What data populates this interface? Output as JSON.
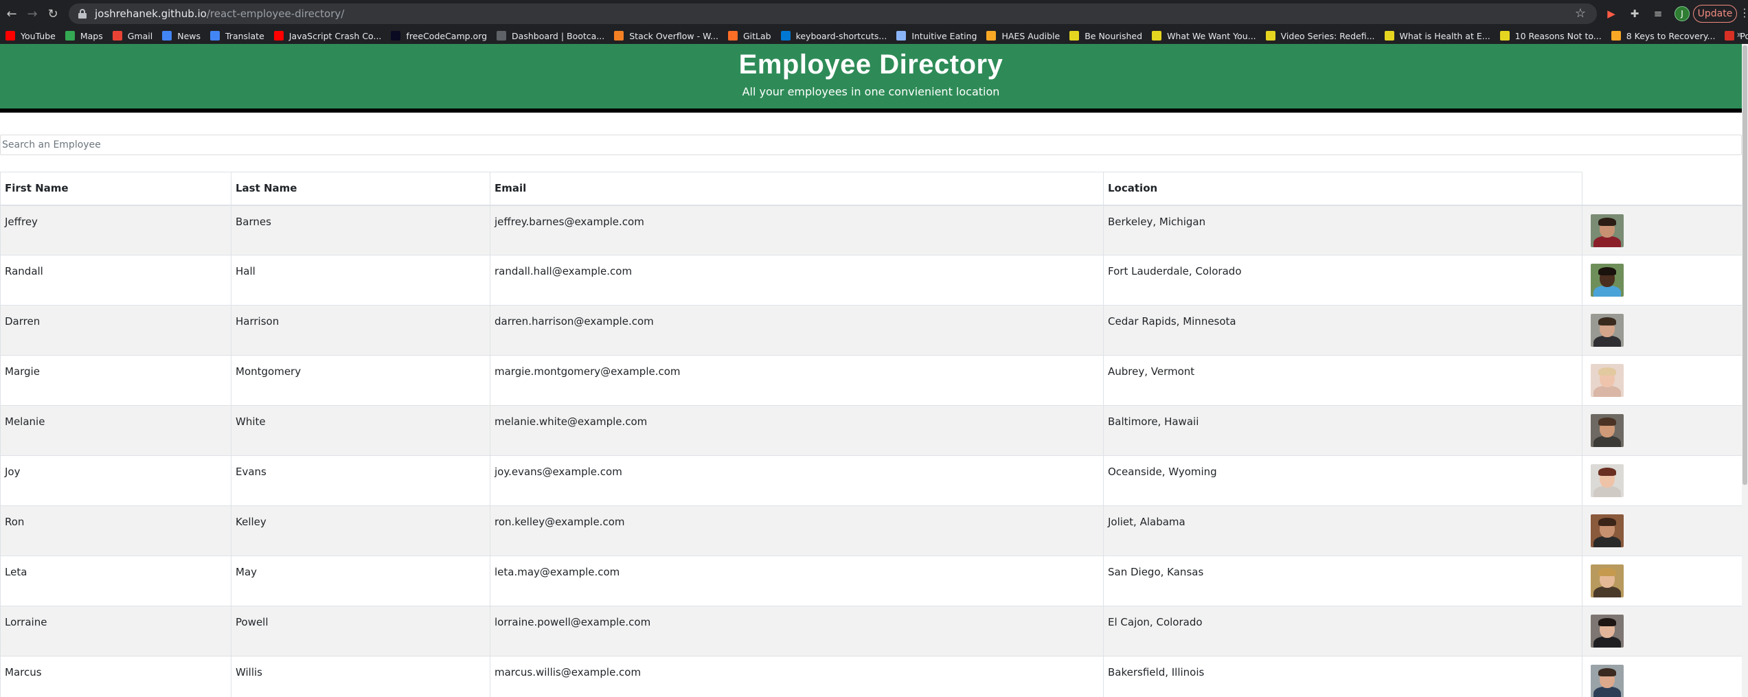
{
  "browser": {
    "url_host": "joshrehanek.github.io",
    "url_path": "/react-employee-directory/",
    "update_label": "Update",
    "profile_initial": "J",
    "bookmarks": [
      {
        "label": "YouTube",
        "color": "#ff0000",
        "icon": "youtube-icon"
      },
      {
        "label": "Maps",
        "color": "#34a853",
        "icon": "maps-icon"
      },
      {
        "label": "Gmail",
        "color": "#ea4335",
        "icon": "gmail-icon"
      },
      {
        "label": "News",
        "color": "#4285f4",
        "icon": "news-icon"
      },
      {
        "label": "Translate",
        "color": "#4285f4",
        "icon": "translate-icon"
      },
      {
        "label": "JavaScript Crash Co...",
        "color": "#ff0000",
        "icon": "youtube-icon"
      },
      {
        "label": "freeCodeCamp.org",
        "color": "#0a0a23",
        "icon": "freecodecamp-icon"
      },
      {
        "label": "Dashboard | Bootca...",
        "color": "#5f6368",
        "icon": "globe-icon"
      },
      {
        "label": "Stack Overflow - W...",
        "color": "#f48024",
        "icon": "stackoverflow-icon"
      },
      {
        "label": "GitLab",
        "color": "#fc6d26",
        "icon": "gitlab-icon"
      },
      {
        "label": "keyboard-shortcuts...",
        "color": "#0078d4",
        "icon": "vscode-icon"
      },
      {
        "label": "Intuitive Eating",
        "color": "#8ab4f8",
        "icon": "drive-icon"
      },
      {
        "label": "HAES Audible",
        "color": "#f9a825",
        "icon": "audible-icon"
      },
      {
        "label": "Be Nourished",
        "color": "#e6d520",
        "icon": "note-icon"
      },
      {
        "label": "What We Want You...",
        "color": "#e6d520",
        "icon": "note-icon"
      },
      {
        "label": "Video Series: Redefi...",
        "color": "#e6d520",
        "icon": "note-icon"
      },
      {
        "label": "What is Health at E...",
        "color": "#e6d520",
        "icon": "note-icon"
      },
      {
        "label": "10 Reasons Not to...",
        "color": "#e6d520",
        "icon": "note-icon"
      },
      {
        "label": "8 Keys to Recovery...",
        "color": "#f9a825",
        "icon": "audible-icon"
      },
      {
        "label": "Podcast — Christy...",
        "color": "#d93025",
        "icon": "podcast-icon"
      }
    ]
  },
  "header": {
    "title": "Employee Directory",
    "subtitle": "All your employees in one convienient location"
  },
  "search": {
    "placeholder": "Search an Employee",
    "value": ""
  },
  "table": {
    "columns": [
      "First Name",
      "Last Name",
      "Email",
      "Location",
      ""
    ],
    "rows": [
      {
        "first": "Jeffrey",
        "last": "Barnes",
        "email": "jeffrey.barnes@example.com",
        "location": "Berkeley, Michigan",
        "photo": {
          "bg": "#7a8c74",
          "skin": "#c89272",
          "hair": "#2b1d14",
          "shirt": "#8a1f2a"
        }
      },
      {
        "first": "Randall",
        "last": "Hall",
        "email": "randall.hall@example.com",
        "location": "Fort Lauderdale, Colorado",
        "photo": {
          "bg": "#6f8f5a",
          "skin": "#4a2e1f",
          "hair": "#1a120c",
          "shirt": "#4aa3d8"
        }
      },
      {
        "first": "Darren",
        "last": "Harrison",
        "email": "darren.harrison@example.com",
        "location": "Cedar Rapids, Minnesota",
        "photo": {
          "bg": "#9a9a94",
          "skin": "#d4a58a",
          "hair": "#3a2a1e",
          "shirt": "#2f2f33"
        }
      },
      {
        "first": "Margie",
        "last": "Montgomery",
        "email": "margie.montgomery@example.com",
        "location": "Aubrey, Vermont",
        "photo": {
          "bg": "#e8d6cc",
          "skin": "#efc4ad",
          "hair": "#e3c9a0",
          "shirt": "#d9b6a6"
        }
      },
      {
        "first": "Melanie",
        "last": "White",
        "email": "melanie.white@example.com",
        "location": "Baltimore, Hawaii",
        "photo": {
          "bg": "#6e6a63",
          "skin": "#d09a78",
          "hair": "#4a3325",
          "shirt": "#3c3a36"
        }
      },
      {
        "first": "Joy",
        "last": "Evans",
        "email": "joy.evans@example.com",
        "location": "Oceanside, Wyoming",
        "photo": {
          "bg": "#dcdad6",
          "skin": "#efc3a8",
          "hair": "#6a2f22",
          "shirt": "#cfcac4"
        }
      },
      {
        "first": "Ron",
        "last": "Kelley",
        "email": "ron.kelley@example.com",
        "location": "Joliet, Alabama",
        "photo": {
          "bg": "#8a5a3c",
          "skin": "#c79170",
          "hair": "#3b2418",
          "shirt": "#2a2a2a"
        }
      },
      {
        "first": "Leta",
        "last": "May",
        "email": "leta.may@example.com",
        "location": "San Diego, Kansas",
        "photo": {
          "bg": "#b89a5e",
          "skin": "#e5b896",
          "hair": "#c69a4e",
          "shirt": "#4a3a2a"
        }
      },
      {
        "first": "Lorraine",
        "last": "Powell",
        "email": "lorraine.powell@example.com",
        "location": "El Cajon, Colorado",
        "photo": {
          "bg": "#7d7672",
          "skin": "#e2b59a",
          "hair": "#1e1612",
          "shirt": "#1f1f22"
        }
      },
      {
        "first": "Marcus",
        "last": "Willis",
        "email": "marcus.willis@example.com",
        "location": "Bakersfield, Illinois",
        "photo": {
          "bg": "#9aa3a8",
          "skin": "#dca98c",
          "hair": "#3a2a20",
          "shirt": "#2c3e56"
        }
      }
    ]
  }
}
